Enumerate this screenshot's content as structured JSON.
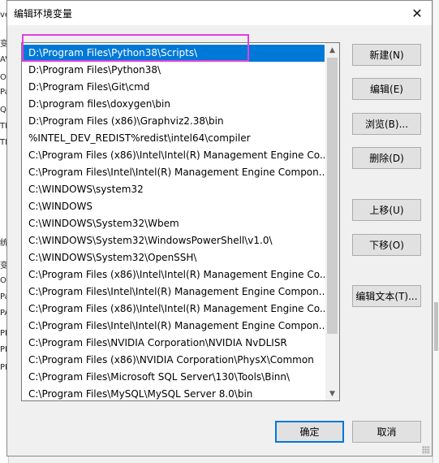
{
  "background": {
    "fragments": [
      "ve",
      "变",
      "AV",
      "O",
      "Pa",
      "Q",
      "TE",
      "TM",
      "统",
      "变",
      "O",
      "Pa",
      "PA",
      "PF",
      "PF",
      "PF"
    ]
  },
  "dialog": {
    "title": "编辑环境变量",
    "close_glyph": "✕"
  },
  "list": {
    "selected_index": 0,
    "items": [
      "D:\\Program Files\\Python38\\Scripts\\",
      "D:\\Program Files\\Python38\\",
      "D:\\Program Files\\Git\\cmd",
      "D:\\program files\\doxygen\\bin",
      "D:\\Program Files (x86)\\Graphviz2.38\\bin",
      "%INTEL_DEV_REDIST%redist\\intel64\\compiler",
      "C:\\Program Files (x86)\\Intel\\Intel(R) Management Engine Co...",
      "C:\\Program Files\\Intel\\Intel(R) Management Engine Compon...",
      "C:\\WINDOWS\\system32",
      "C:\\WINDOWS",
      "C:\\WINDOWS\\System32\\Wbem",
      "C:\\WINDOWS\\System32\\WindowsPowerShell\\v1.0\\",
      "C:\\WINDOWS\\System32\\OpenSSH\\",
      "C:\\Program Files (x86)\\Intel\\Intel(R) Management Engine Co...",
      "C:\\Program Files\\Intel\\Intel(R) Management Engine Compon...",
      "C:\\Program Files (x86)\\Intel\\Intel(R) Management Engine Co...",
      "C:\\Program Files\\Intel\\Intel(R) Management Engine Compon...",
      "C:\\Program Files\\NVIDIA Corporation\\NVIDIA NvDLISR",
      "C:\\Program Files (x86)\\NVIDIA Corporation\\PhysX\\Common",
      "C:\\Program Files\\Microsoft SQL Server\\130\\Tools\\Binn\\",
      "C:\\Program Files\\MySQL\\MySQL Server 8.0\\bin"
    ]
  },
  "buttons": {
    "new": "新建(N)",
    "edit": "编辑(E)",
    "browse": "浏览(B)...",
    "delete": "删除(D)",
    "move_up": "上移(U)",
    "move_down": "下移(O)",
    "edit_text": "编辑文本(T)...",
    "ok": "确定",
    "cancel": "取消"
  },
  "icons": {
    "scroll_up": "▲",
    "scroll_down": "▼"
  },
  "colors": {
    "selection": "#0078d7",
    "highlight_annotation": "#e040e0"
  }
}
